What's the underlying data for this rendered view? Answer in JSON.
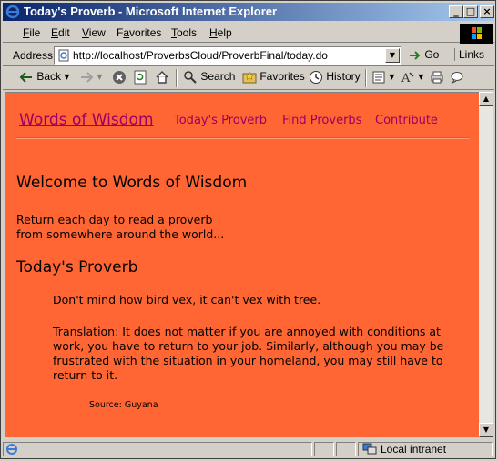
{
  "window": {
    "title": "Today's Proverb - Microsoft Internet Explorer",
    "controls": {
      "minimize": "_",
      "maximize": "□",
      "close": "×"
    }
  },
  "menubar": {
    "items": [
      {
        "label": "File",
        "u": "F",
        "rest": "ile"
      },
      {
        "label": "Edit",
        "u": "E",
        "rest": "dit"
      },
      {
        "label": "View",
        "u": "V",
        "rest": "iew"
      },
      {
        "label": "Favorites",
        "u": "a",
        "pre": "F",
        "rest": "vorites"
      },
      {
        "label": "Tools",
        "u": "T",
        "rest": "ools"
      },
      {
        "label": "Help",
        "u": "H",
        "rest": "elp"
      }
    ]
  },
  "address": {
    "label": "Address",
    "url": "http://localhost/ProverbsCloud/ProverbFinal/today.do",
    "go": "Go",
    "links": "Links"
  },
  "toolbar": {
    "back": "Back",
    "search": "Search",
    "favorites": "Favorites",
    "history": "History"
  },
  "page": {
    "site_title": "Words of Wisdom",
    "nav": [
      "Today's Proverb",
      "Find Proverbs",
      "Contribute"
    ],
    "welcome_heading": "Welcome to Words of Wisdom",
    "intro_line1": "Return each day to read a proverb",
    "intro_line2": "from somewhere around the world...",
    "today_heading": "Today's Proverb",
    "proverb": "Don't mind how bird vex, it can't vex with tree.",
    "translation": "Translation: It does not matter if you are annoyed with conditions at work, you have to return to your job. Similarly, although you may be frustrated with the situation in your homeland, you may still have to return to it.",
    "source": "Source: Guyana"
  },
  "statusbar": {
    "zone": "Local intranet"
  },
  "colors": {
    "page_bg": "#ff6633",
    "link": "#990066",
    "titlebar_start": "#0a246a",
    "titlebar_end": "#a6caf0"
  }
}
